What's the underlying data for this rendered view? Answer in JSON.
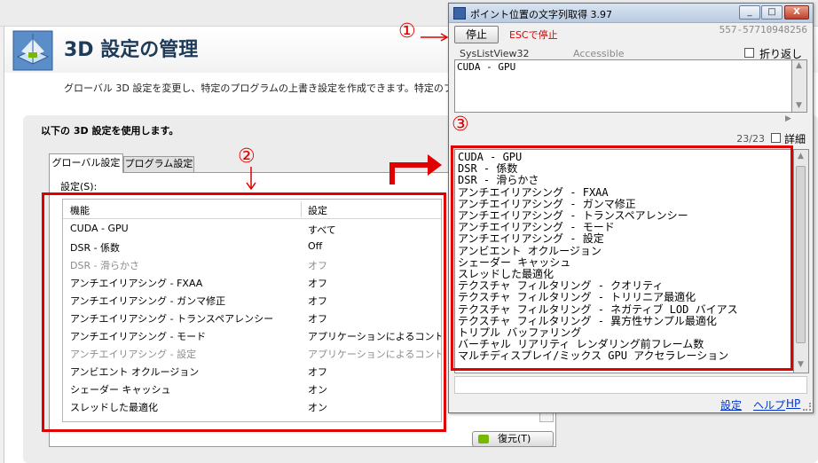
{
  "nvidia": {
    "title": "3D 設定の管理",
    "description": "グローバル 3D 設定を変更し、特定のプログラムの上書き設定を作成できます。特定のプログラ",
    "section_title": "以下の 3D 設定を使用します。",
    "tabs": [
      "グローバル設定",
      "プログラム設定"
    ],
    "settings_label": "設定(S):",
    "columns": [
      "機能",
      "設定"
    ],
    "rows": [
      {
        "feature": "CUDA - GPU",
        "value": "すべて",
        "disabled": false
      },
      {
        "feature": "DSR - 係数",
        "value": "Off",
        "disabled": false
      },
      {
        "feature": "DSR - 滑らかさ",
        "value": "オフ",
        "disabled": true
      },
      {
        "feature": "アンチエイリアシング - FXAA",
        "value": "オフ",
        "disabled": false
      },
      {
        "feature": "アンチエイリアシング - ガンマ修正",
        "value": "オフ",
        "disabled": false
      },
      {
        "feature": "アンチエイリアシング - トランスペアレンシー",
        "value": "オフ",
        "disabled": false
      },
      {
        "feature": "アンチエイリアシング - モード",
        "value": "アプリケーションによるコントロール",
        "disabled": false
      },
      {
        "feature": "アンチエイリアシング - 設定",
        "value": "アプリケーションによるコントロール",
        "disabled": true
      },
      {
        "feature": "アンビエント オクルージョン",
        "value": "オフ",
        "disabled": false
      },
      {
        "feature": "シェーダー キャッシュ",
        "value": "オン",
        "disabled": false
      },
      {
        "feature": "スレッドした最適化",
        "value": "オン",
        "disabled": false
      }
    ],
    "restore_label": "復元(T)"
  },
  "tool": {
    "title": "ポイント位置の文字列取得 3.97",
    "window_buttons": {
      "minimize": "_",
      "maximize": "□",
      "close": "X"
    },
    "stop_label": "停止",
    "esc_note": "ESCで停止",
    "handle": "557-57710948256",
    "class_name": "SysListView32",
    "access_state": "Accessible",
    "wrap_label": "折り返し",
    "caption_text": "CUDA - GPU",
    "count": "23/23",
    "detail_label": "詳細",
    "list_items": [
      "CUDA - GPU",
      "DSR - 係数",
      "DSR - 滑らかさ",
      "アンチエイリアシング - FXAA",
      "アンチエイリアシング - ガンマ修正",
      "アンチエイリアシング - トランスペアレンシー",
      "アンチエイリアシング - モード",
      "アンチエイリアシング - 設定",
      "アンビエント オクルージョン",
      "シェーダー キャッシュ",
      "スレッドした最適化",
      "テクスチャ フィルタリング - クオリティ",
      "テクスチャ フィルタリング - トリリニア最適化",
      "テクスチャ フィルタリング - ネガティブ LOD バイアス",
      "テクスチャ フィルタリング - 異方性サンプル最適化",
      "トリプル バッファリング",
      "バーチャル リアリティ レンダリング前フレーム数",
      "マルチディスプレイ/ミックス GPU アクセラレーション"
    ],
    "links": {
      "settings": "設定",
      "help": "ヘルプ",
      "hp": "HP"
    }
  },
  "annotations": {
    "one": "①",
    "two": "②",
    "three": "③",
    "color": "#e00000"
  }
}
